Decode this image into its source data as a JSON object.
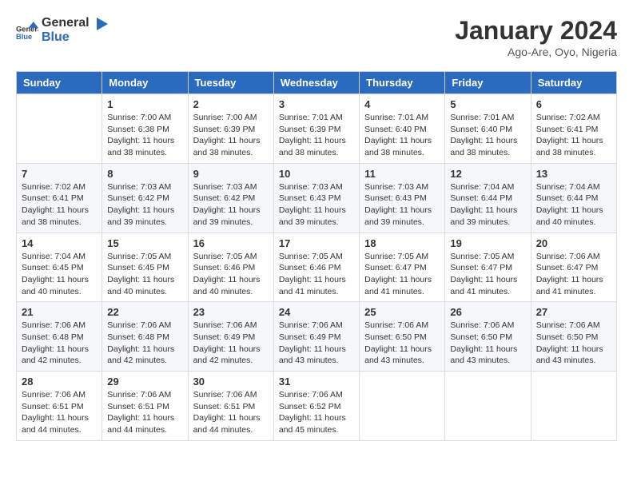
{
  "header": {
    "logo_general": "General",
    "logo_blue": "Blue",
    "title": "January 2024",
    "subtitle": "Ago-Are, Oyo, Nigeria"
  },
  "weekdays": [
    "Sunday",
    "Monday",
    "Tuesday",
    "Wednesday",
    "Thursday",
    "Friday",
    "Saturday"
  ],
  "weeks": [
    [
      {
        "day": "",
        "info": ""
      },
      {
        "day": "1",
        "info": "Sunrise: 7:00 AM\nSunset: 6:38 PM\nDaylight: 11 hours\nand 38 minutes."
      },
      {
        "day": "2",
        "info": "Sunrise: 7:00 AM\nSunset: 6:39 PM\nDaylight: 11 hours\nand 38 minutes."
      },
      {
        "day": "3",
        "info": "Sunrise: 7:01 AM\nSunset: 6:39 PM\nDaylight: 11 hours\nand 38 minutes."
      },
      {
        "day": "4",
        "info": "Sunrise: 7:01 AM\nSunset: 6:40 PM\nDaylight: 11 hours\nand 38 minutes."
      },
      {
        "day": "5",
        "info": "Sunrise: 7:01 AM\nSunset: 6:40 PM\nDaylight: 11 hours\nand 38 minutes."
      },
      {
        "day": "6",
        "info": "Sunrise: 7:02 AM\nSunset: 6:41 PM\nDaylight: 11 hours\nand 38 minutes."
      }
    ],
    [
      {
        "day": "7",
        "info": "Sunrise: 7:02 AM\nSunset: 6:41 PM\nDaylight: 11 hours\nand 38 minutes."
      },
      {
        "day": "8",
        "info": "Sunrise: 7:03 AM\nSunset: 6:42 PM\nDaylight: 11 hours\nand 39 minutes."
      },
      {
        "day": "9",
        "info": "Sunrise: 7:03 AM\nSunset: 6:42 PM\nDaylight: 11 hours\nand 39 minutes."
      },
      {
        "day": "10",
        "info": "Sunrise: 7:03 AM\nSunset: 6:43 PM\nDaylight: 11 hours\nand 39 minutes."
      },
      {
        "day": "11",
        "info": "Sunrise: 7:03 AM\nSunset: 6:43 PM\nDaylight: 11 hours\nand 39 minutes."
      },
      {
        "day": "12",
        "info": "Sunrise: 7:04 AM\nSunset: 6:44 PM\nDaylight: 11 hours\nand 39 minutes."
      },
      {
        "day": "13",
        "info": "Sunrise: 7:04 AM\nSunset: 6:44 PM\nDaylight: 11 hours\nand 40 minutes."
      }
    ],
    [
      {
        "day": "14",
        "info": "Sunrise: 7:04 AM\nSunset: 6:45 PM\nDaylight: 11 hours\nand 40 minutes."
      },
      {
        "day": "15",
        "info": "Sunrise: 7:05 AM\nSunset: 6:45 PM\nDaylight: 11 hours\nand 40 minutes."
      },
      {
        "day": "16",
        "info": "Sunrise: 7:05 AM\nSunset: 6:46 PM\nDaylight: 11 hours\nand 40 minutes."
      },
      {
        "day": "17",
        "info": "Sunrise: 7:05 AM\nSunset: 6:46 PM\nDaylight: 11 hours\nand 41 minutes."
      },
      {
        "day": "18",
        "info": "Sunrise: 7:05 AM\nSunset: 6:47 PM\nDaylight: 11 hours\nand 41 minutes."
      },
      {
        "day": "19",
        "info": "Sunrise: 7:05 AM\nSunset: 6:47 PM\nDaylight: 11 hours\nand 41 minutes."
      },
      {
        "day": "20",
        "info": "Sunrise: 7:06 AM\nSunset: 6:47 PM\nDaylight: 11 hours\nand 41 minutes."
      }
    ],
    [
      {
        "day": "21",
        "info": "Sunrise: 7:06 AM\nSunset: 6:48 PM\nDaylight: 11 hours\nand 42 minutes."
      },
      {
        "day": "22",
        "info": "Sunrise: 7:06 AM\nSunset: 6:48 PM\nDaylight: 11 hours\nand 42 minutes."
      },
      {
        "day": "23",
        "info": "Sunrise: 7:06 AM\nSunset: 6:49 PM\nDaylight: 11 hours\nand 42 minutes."
      },
      {
        "day": "24",
        "info": "Sunrise: 7:06 AM\nSunset: 6:49 PM\nDaylight: 11 hours\nand 43 minutes."
      },
      {
        "day": "25",
        "info": "Sunrise: 7:06 AM\nSunset: 6:50 PM\nDaylight: 11 hours\nand 43 minutes."
      },
      {
        "day": "26",
        "info": "Sunrise: 7:06 AM\nSunset: 6:50 PM\nDaylight: 11 hours\nand 43 minutes."
      },
      {
        "day": "27",
        "info": "Sunrise: 7:06 AM\nSunset: 6:50 PM\nDaylight: 11 hours\nand 43 minutes."
      }
    ],
    [
      {
        "day": "28",
        "info": "Sunrise: 7:06 AM\nSunset: 6:51 PM\nDaylight: 11 hours\nand 44 minutes."
      },
      {
        "day": "29",
        "info": "Sunrise: 7:06 AM\nSunset: 6:51 PM\nDaylight: 11 hours\nand 44 minutes."
      },
      {
        "day": "30",
        "info": "Sunrise: 7:06 AM\nSunset: 6:51 PM\nDaylight: 11 hours\nand 44 minutes."
      },
      {
        "day": "31",
        "info": "Sunrise: 7:06 AM\nSunset: 6:52 PM\nDaylight: 11 hours\nand 45 minutes."
      },
      {
        "day": "",
        "info": ""
      },
      {
        "day": "",
        "info": ""
      },
      {
        "day": "",
        "info": ""
      }
    ]
  ]
}
